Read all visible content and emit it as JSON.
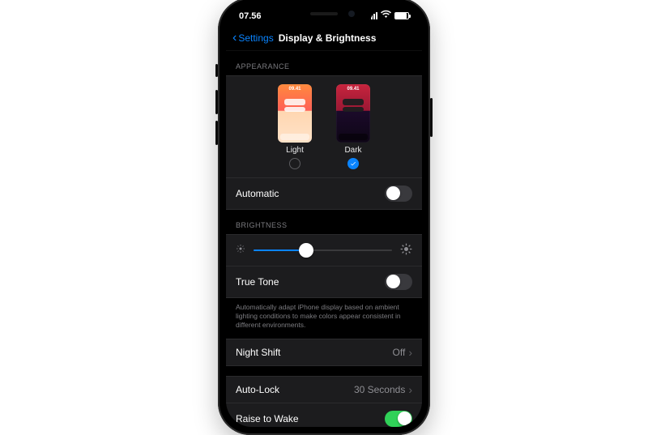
{
  "status": {
    "time": "07.56"
  },
  "nav": {
    "back_label": "Settings",
    "title": "Display & Brightness"
  },
  "sections": {
    "appearance_header": "APPEARANCE",
    "brightness_header": "BRIGHTNESS"
  },
  "appearance": {
    "light": {
      "label": "Light",
      "thumb_time": "09.41",
      "selected": false
    },
    "dark": {
      "label": "Dark",
      "thumb_time": "09.41",
      "selected": true
    },
    "automatic": {
      "label": "Automatic",
      "enabled": false
    }
  },
  "brightness": {
    "value_percent": 38,
    "true_tone": {
      "label": "True Tone",
      "enabled": false
    },
    "true_tone_note": "Automatically adapt iPhone display based on ambient lighting conditions to make colors appear consistent in different environments."
  },
  "night_shift": {
    "label": "Night Shift",
    "value": "Off"
  },
  "auto_lock": {
    "label": "Auto-Lock",
    "value": "30 Seconds"
  },
  "raise_to_wake": {
    "label": "Raise to Wake",
    "enabled": true
  }
}
